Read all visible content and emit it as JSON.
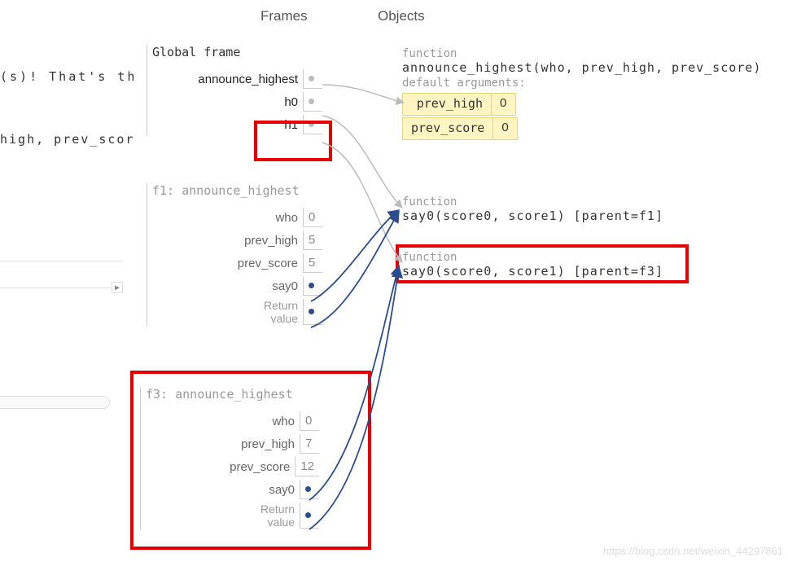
{
  "headers": {
    "frames": "Frames",
    "objects": "Objects"
  },
  "left_text": {
    "line1": "(s)! That's th",
    "line2": "high, prev_scor"
  },
  "global_frame": {
    "title": "Global frame",
    "vars": {
      "announce_highest": "announce_highest",
      "h0": "h0",
      "h1": "h1"
    }
  },
  "f1": {
    "title_prefix": "f1: ",
    "title_name": "announce_highest",
    "who": {
      "label": "who",
      "value": "0"
    },
    "prev_high": {
      "label": "prev_high",
      "value": "5"
    },
    "prev_score": {
      "label": "prev_score",
      "value": "5"
    },
    "say0": {
      "label": "say0"
    },
    "return": {
      "label1": "Return",
      "label2": "value"
    }
  },
  "f3": {
    "title_prefix": "f3: ",
    "title_name": "announce_highest",
    "who": {
      "label": "who",
      "value": "0"
    },
    "prev_high": {
      "label": "prev_high",
      "value": "7"
    },
    "prev_score": {
      "label": "prev_score",
      "value": "12"
    },
    "say0": {
      "label": "say0"
    },
    "return": {
      "label1": "Return",
      "label2": "value"
    }
  },
  "objects": {
    "fn_announce": {
      "kw": "function",
      "sig": "announce_highest(who,  prev_high,  prev_score)",
      "def_label": "default arguments:",
      "defaults": [
        {
          "k": "prev_high",
          "v": "0"
        },
        {
          "k": "prev_score",
          "v": "0"
        }
      ]
    },
    "fn_say0_f1": {
      "kw": "function",
      "sig": "say0(score0,  score1) [parent=f1]"
    },
    "fn_say0_f3": {
      "kw": "function",
      "sig": "say0(score0,  score1) [parent=f3]"
    }
  },
  "watermark": "https://blog.csdn.net/weixin_44297861"
}
